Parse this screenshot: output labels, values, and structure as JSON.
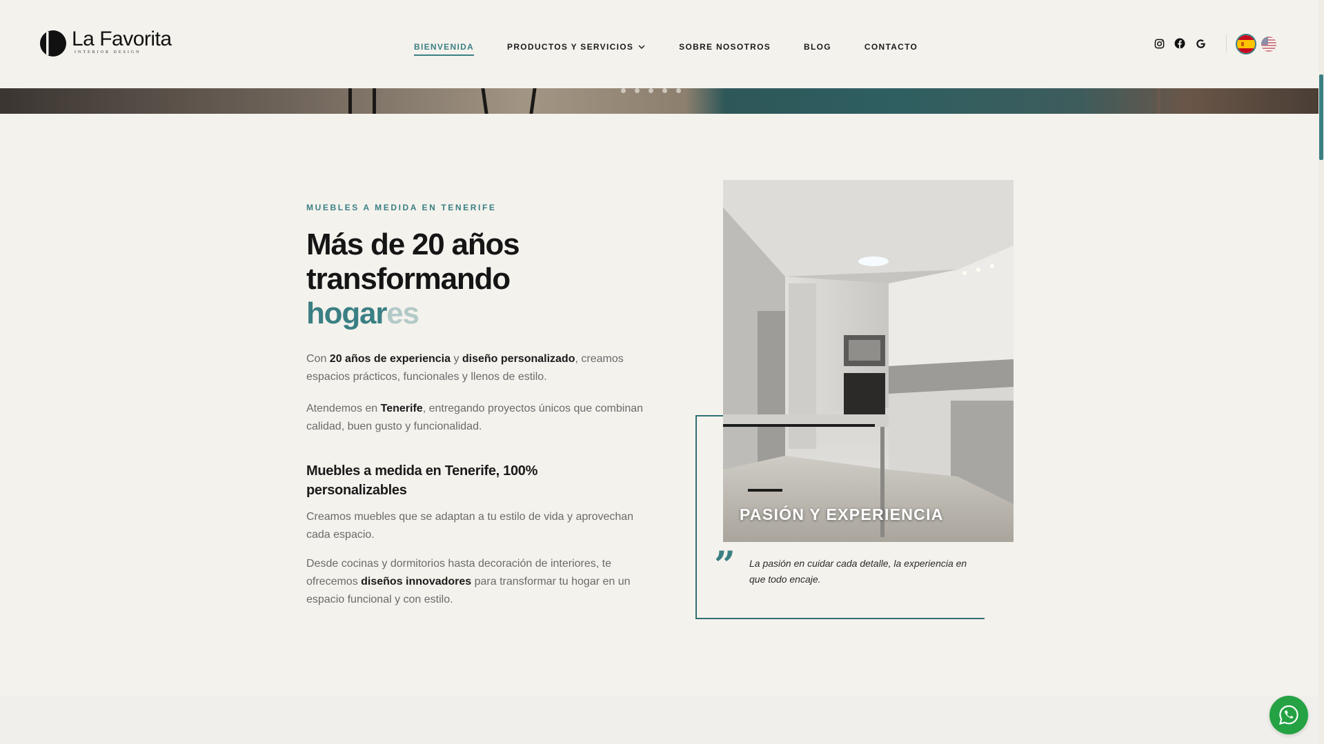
{
  "brand": {
    "name": "La Favorita",
    "tagline": "INTERIOR DESIGN",
    "logo_icon": "half-circle-logo-icon"
  },
  "nav": {
    "items": [
      {
        "label": "BIENVENIDA",
        "active": true
      },
      {
        "label": "PRODUCTOS Y SERVICIOS",
        "has_dropdown": true
      },
      {
        "label": "SOBRE NOSOTROS"
      },
      {
        "label": "BLOG"
      },
      {
        "label": "CONTACTO"
      }
    ]
  },
  "social": {
    "icons": [
      "instagram-icon",
      "facebook-icon",
      "google-icon"
    ]
  },
  "languages": [
    {
      "code": "es",
      "icon": "spain-flag-icon",
      "selected": true
    },
    {
      "code": "en",
      "icon": "us-flag-icon",
      "selected": false
    }
  ],
  "colors": {
    "accent": "#3a7f83",
    "background": "#f4f2ed",
    "whatsapp": "#25a244"
  },
  "intro": {
    "eyebrow": "MUEBLES A MEDIDA EN TENERIFE",
    "title_line1": "Más de 20 años",
    "title_line2": "transformando",
    "title_accent": "hogar",
    "title_fade": "es",
    "p1_a": "Con ",
    "p1_b": "20 años de experiencia",
    "p1_c": " y ",
    "p1_d": "diseño personalizado",
    "p1_e": ", creamos espacios prácticos, funcionales y llenos de estilo.",
    "p2_a": "Atendemos en ",
    "p2_b": "Tenerife",
    "p2_c": ", entregando proyectos únicos que combinan calidad, buen gusto y funcionalidad.",
    "subtitle": "Muebles a medida en Tenerife, 100% personalizables",
    "p3": "Creamos muebles que se adaptan a tu estilo de vida y aprovechan cada espacio.",
    "p4_a": "Desde cocinas y dormitorios hasta decoración de interiores, te ofrecemos ",
    "p4_b": "diseños innovadores",
    "p4_c": " para transformar tu hogar en un espacio funcional y con estilo."
  },
  "card": {
    "caption": "PASIÓN Y EXPERIENCIA",
    "quote_mark": "”",
    "quote": "La pasión en cuidar cada detalle, la experiencia en que todo encaje."
  },
  "whatsapp": {
    "icon": "whatsapp-icon"
  }
}
